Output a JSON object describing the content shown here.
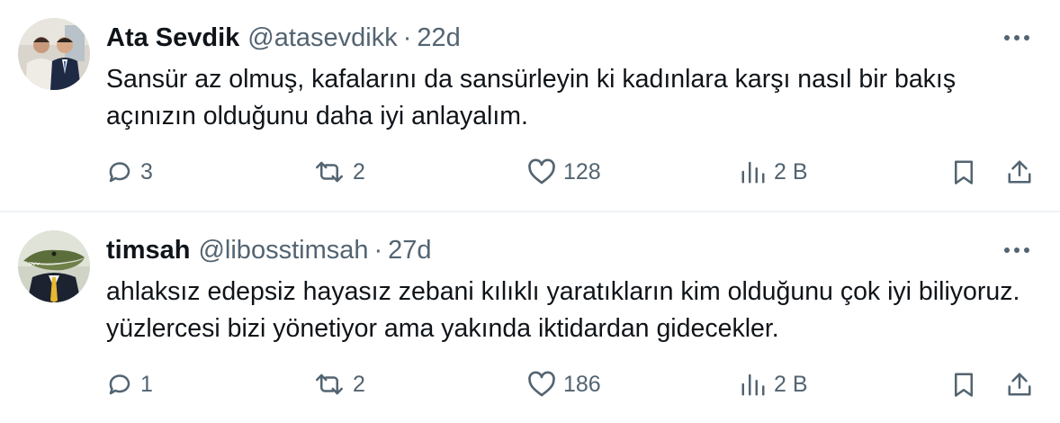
{
  "tweets": [
    {
      "author_name": "Ata Sevdik",
      "handle": "@atasevdikk",
      "separator": "·",
      "time": "22d",
      "text": "Sansür az olmuş, kafalarını da sansürleyin ki kadınlara karşı nasıl bir bakış açınızın olduğunu daha iyi anlayalım.",
      "replies": "3",
      "retweets": "2",
      "likes": "128",
      "views": "2 B"
    },
    {
      "author_name": "timsah",
      "handle": "@libosstimsah",
      "separator": "·",
      "time": "27d",
      "text": "ahlaksız edepsiz hayasız zebani kılıklı yaratıkların kim olduğunu çok iyi biliyoruz. yüzlercesi bizi yönetiyor ama yakında iktidardan gidecekler.",
      "replies": "1",
      "retweets": "2",
      "likes": "186",
      "views": "2 B"
    }
  ],
  "icons": {
    "more": "more-horizontal-icon",
    "reply": "reply-bubble-icon",
    "retweet": "retweet-icon",
    "like": "heart-icon",
    "views": "bar-chart-icon",
    "bookmark": "bookmark-icon",
    "share": "share-upload-icon"
  },
  "colors": {
    "text_primary": "#0f1419",
    "text_secondary": "#536471",
    "divider": "#eff3f4"
  }
}
